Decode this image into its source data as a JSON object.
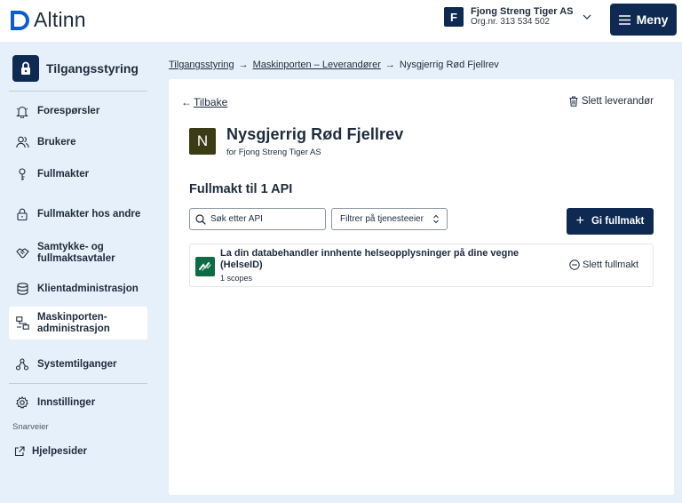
{
  "header": {
    "logo_text": "Altinn",
    "org_initial": "F",
    "org_name": "Fjong Streng Tiger AS",
    "org_number": "Org.nr. 313 534 502",
    "menu_label": "Meny"
  },
  "sidebar": {
    "heading": "Tilgangsstyring",
    "items": [
      {
        "label": "Forespørsler",
        "icon": "bell-icon"
      },
      {
        "label": "Brukere",
        "icon": "users-icon"
      },
      {
        "label": "Fullmakter",
        "icon": "key-icon"
      },
      {
        "label": "Fullmakter hos andre",
        "icon": "lock-icon"
      },
      {
        "label": "Samtykke- og fullmaktsavtaler",
        "icon": "handshake-icon"
      },
      {
        "label": "Klientadministrasjon",
        "icon": "database-icon"
      },
      {
        "label": "Maskinporten-administrasjon",
        "icon": "network-icon",
        "active": true
      },
      {
        "label": "Systemtilganger",
        "icon": "hierarchy-icon"
      },
      {
        "label": "Innstillinger",
        "icon": "gear-icon"
      }
    ],
    "shortcuts_title": "Snarveier",
    "help_label": "Hjelpesider"
  },
  "breadcrumb": {
    "items": [
      "Tilgangsstyring",
      "Maskinporten – Leverandører"
    ],
    "current": "Nysgjerrig Rød Fjellrev"
  },
  "main": {
    "back_label": "Tilbake",
    "delete_vendor_label": "Slett leverandør",
    "vendor_initial": "N",
    "vendor_name": "Nysgjerrig Rød Fjellrev",
    "vendor_for": "for Fjong Streng Tiger AS",
    "section_title": "Fullmakt til 1 API",
    "search_placeholder": "Søk etter API",
    "filter_label": "Filtrer på tjenesteeier",
    "give_button_label": "Gi fullmakt",
    "apis": [
      {
        "title": "La din databehandler innhente helseopplysninger på dine vegne (HelseID)",
        "scopes": "1 scopes",
        "delete_label": "Slett fullmakt"
      }
    ]
  },
  "colors": {
    "brand_navy": "#0e2a52",
    "page_bg": "#e6f0fa",
    "vendor_avatar": "#3b3b16",
    "api_logo": "#0f6b47"
  }
}
